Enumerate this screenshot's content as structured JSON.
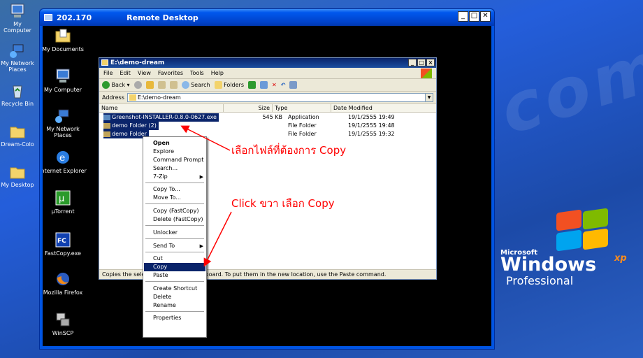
{
  "outer_desktop": {
    "icons": [
      {
        "label": "My Computer",
        "icon": "my-computer-icon"
      },
      {
        "label": "My Network Places",
        "icon": "network-places-icon"
      },
      {
        "label": "Recycle Bin",
        "icon": "recycle-bin-icon"
      },
      {
        "label": "Dream-Colo",
        "icon": "folder-icon"
      },
      {
        "label": "My Desktop",
        "icon": "folder-icon"
      }
    ]
  },
  "remote_window": {
    "host": "202.170",
    "title": "Remote Desktop",
    "controls": {
      "minimize": "_",
      "maximize": "□",
      "close": "✕"
    }
  },
  "inner_desktop": {
    "icons": [
      {
        "label": "My Documents",
        "icon": "documents-folder-icon"
      },
      {
        "label": "My Computer",
        "icon": "my-computer-icon"
      },
      {
        "label": "My Network Places",
        "icon": "network-places-icon"
      },
      {
        "label": "Internet Explorer",
        "icon": "internet-explorer-icon"
      },
      {
        "label": "µTorrent",
        "icon": "utorrent-icon"
      },
      {
        "label": "FastCopy.exe",
        "icon": "fastcopy-icon"
      },
      {
        "label": "Mozilla Firefox",
        "icon": "firefox-icon"
      },
      {
        "label": "WinSCP",
        "icon": "winscp-icon"
      }
    ]
  },
  "explorer": {
    "title": "E:\\demo-dream",
    "menu": [
      "File",
      "Edit",
      "View",
      "Favorites",
      "Tools",
      "Help"
    ],
    "toolbar": {
      "back": "Back",
      "search": "Search",
      "folders": "Folders"
    },
    "address_label": "Address",
    "address_value": "E:\\demo-dream",
    "columns": [
      "Name",
      "Size",
      "Type",
      "Date Modified"
    ],
    "rows": [
      {
        "name": "Greenshot-INSTALLER-0.8.0-0627.exe",
        "size": "545 KB",
        "type": "Application",
        "date": "19/1/2555 19:49"
      },
      {
        "name": "demo Folder (2)",
        "size": "",
        "type": "File Folder",
        "date": "19/1/2555 19:48"
      },
      {
        "name": "demo Folder",
        "size": "",
        "type": "File Folder",
        "date": "19/1/2555 19:32"
      }
    ],
    "status": "Copies the selected items to the Clipboard. To put them in the new location, use the Paste command."
  },
  "context_menu": {
    "items": [
      "Open",
      "Explore",
      "Command Prompt",
      "Search...",
      "7-Zip",
      "Copy To...",
      "Move To...",
      "Copy  (FastCopy)",
      "Delete (FastCopy)",
      "Unlocker",
      "Send To",
      "Cut",
      "Copy",
      "Paste",
      "Create Shortcut",
      "Delete",
      "Rename",
      "Properties"
    ]
  },
  "annotations": {
    "note1": "เลือกไฟล์ที่ต้องการ Copy",
    "note2": "Click ขวา เลือก Copy",
    "color": "#ff0000"
  },
  "xp_branding": {
    "microsoft": "Microsoft",
    "windows": "Windows",
    "xp": "xp",
    "edition": "Professional"
  },
  "watermark": "DreamColo.com"
}
